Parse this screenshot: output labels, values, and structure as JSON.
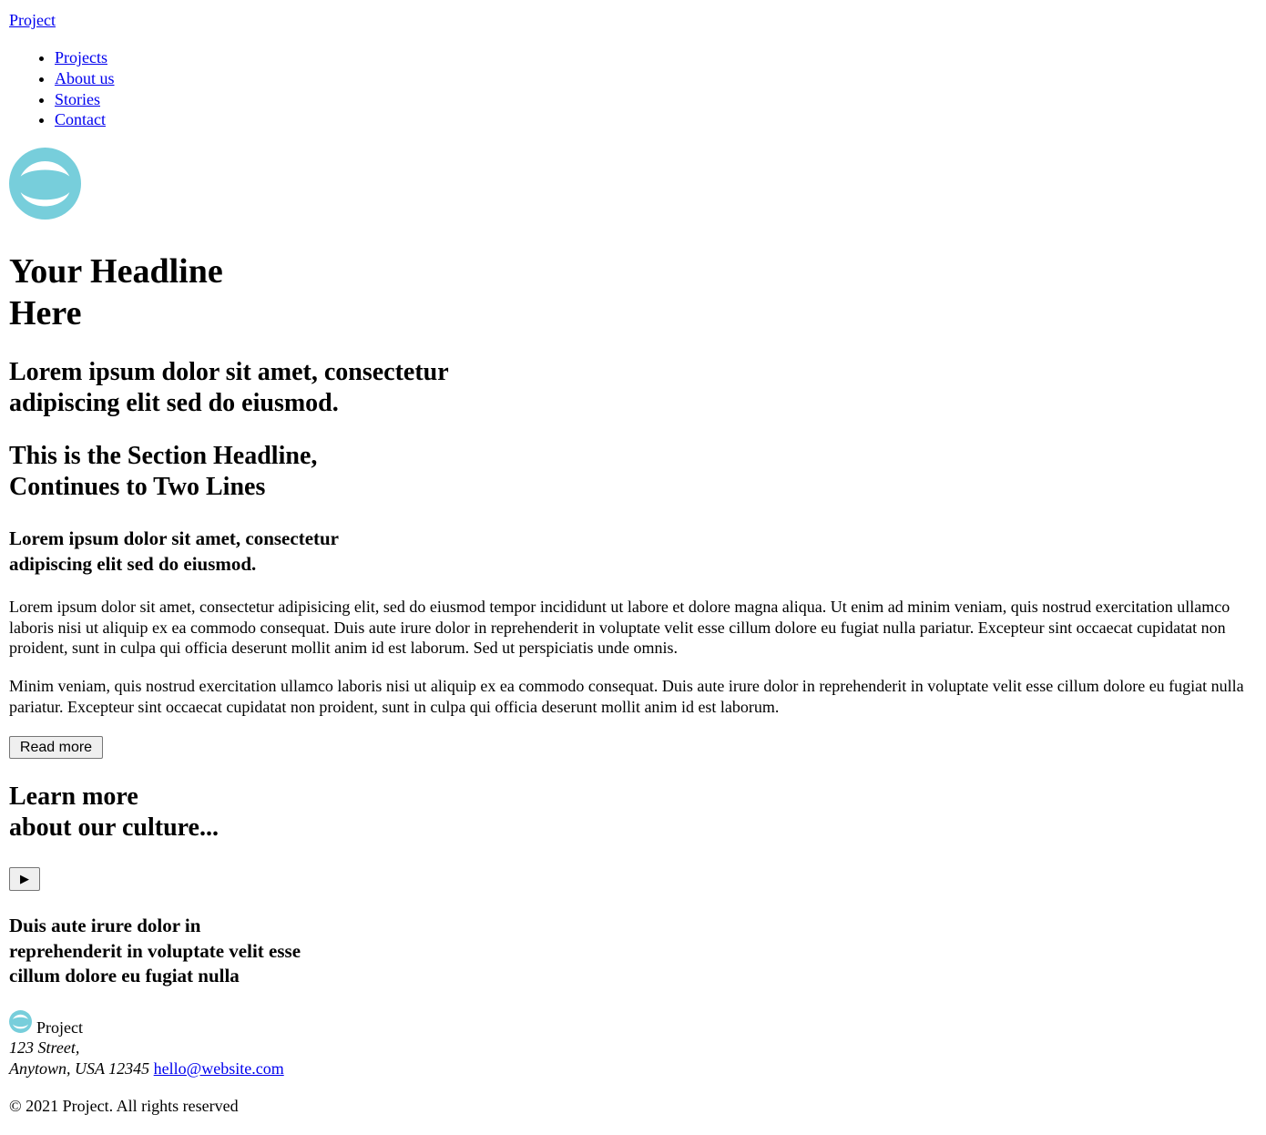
{
  "header": {
    "brand": "Project",
    "nav": [
      "Projects",
      "About us",
      "Stories",
      "Contact"
    ]
  },
  "logo": {
    "icon": "wave-circle-logo",
    "color": "#77cedb"
  },
  "hero": {
    "headline_line1": "Your Headline",
    "headline_line2": "Here",
    "subheadline_line1": "Lorem ipsum dolor sit amet, consectetur",
    "subheadline_line2": "adipiscing elit sed do eiusmod."
  },
  "section": {
    "headline_line1": "This is the Section Headline,",
    "headline_line2": "Continues to Two Lines",
    "subheadline_line1": "Lorem ipsum dolor sit amet, consectetur",
    "subheadline_line2": "adipiscing elit sed do eiusmod.",
    "paragraph1": "Lorem ipsum dolor sit amet, consectetur adipisicing elit, sed do eiusmod tempor incididunt ut labore et dolore magna aliqua. Ut enim ad minim veniam, quis nostrud exercitation ullamco laboris nisi ut aliquip ex ea commodo consequat. Duis aute irure dolor in reprehenderit in voluptate velit esse cillum dolore eu fugiat nulla pariatur. Excepteur sint occaecat cupidatat non proident, sunt in culpa qui officia deserunt mollit anim id est laborum. Sed ut perspiciatis unde omnis.",
    "paragraph2": "Minim veniam, quis nostrud exercitation ullamco laboris nisi ut aliquip ex ea commodo consequat. Duis aute irure dolor in reprehenderit in voluptate velit esse cillum dolore eu fugiat nulla pariatur. Excepteur sint occaecat cupidatat non proident, sunt in culpa qui officia deserunt mollit anim id est laborum.",
    "button_label": "Read more"
  },
  "culture": {
    "headline_line1": "Learn more",
    "headline_line2": "about our culture...",
    "play_icon": "▶",
    "quote_line1": "Duis aute irure dolor in",
    "quote_line2": "reprehenderit in voluptate velit esse",
    "quote_line3": "cillum dolore eu fugiat nulla"
  },
  "footer": {
    "name": "Project",
    "address_line1": "123 Street,",
    "address_line2": "Anytown, USA 12345",
    "email": "hello@website.com",
    "copyright": "© 2021 Project. All rights reserved"
  }
}
